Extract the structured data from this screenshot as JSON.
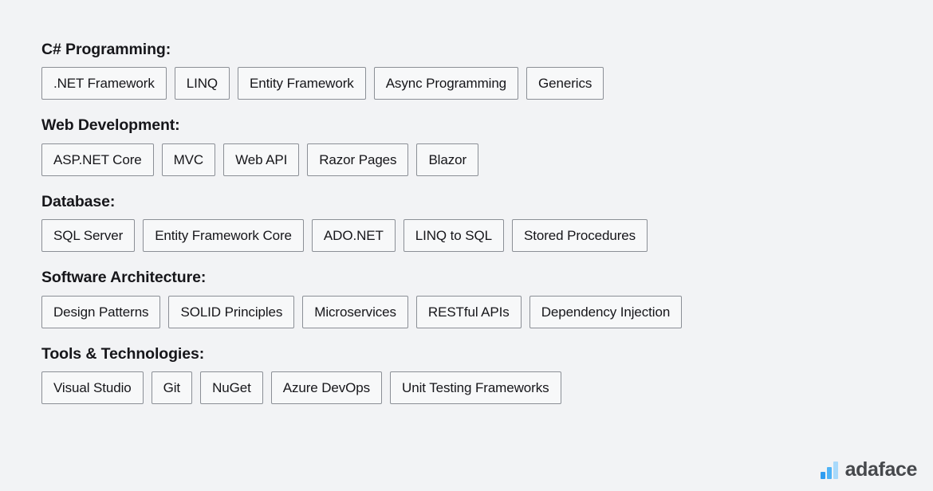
{
  "page": {
    "background_color": "#f2f3f5",
    "text_color": "#16161a",
    "tag_border_color": "#8b8f96",
    "tag_fill_color": "#f7f8f9"
  },
  "sections": [
    {
      "heading": "C# Programming:",
      "tags": [
        ".NET Framework",
        "LINQ",
        "Entity Framework",
        "Async Programming",
        "Generics"
      ]
    },
    {
      "heading": "Web Development:",
      "tags": [
        "ASP.NET Core",
        "MVC",
        "Web API",
        "Razor Pages",
        "Blazor"
      ]
    },
    {
      "heading": "Database:",
      "tags": [
        "SQL Server",
        "Entity Framework Core",
        "ADO.NET",
        "LINQ to SQL",
        "Stored Procedures"
      ]
    },
    {
      "heading": "Software Architecture:",
      "tags": [
        "Design Patterns",
        "SOLID Principles",
        "Microservices",
        "RESTful APIs",
        "Dependency Injection"
      ]
    },
    {
      "heading": "Tools & Technologies:",
      "tags": [
        "Visual Studio",
        "Git",
        "NuGet",
        "Azure DevOps",
        "Unit Testing Frameworks"
      ]
    }
  ],
  "brand": {
    "name": "adaface",
    "logo_icon": "bar-chart-icon",
    "bar_colors": [
      "#2f9cf0",
      "#4fb3f6",
      "#a8d9fb"
    ],
    "text_color": "#46484c"
  }
}
